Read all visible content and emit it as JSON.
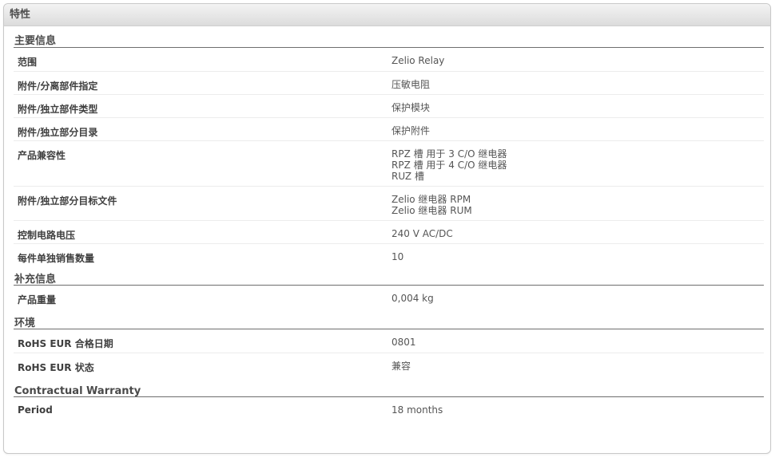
{
  "panel": {
    "title": "特性"
  },
  "sections": [
    {
      "title": "主要信息",
      "rows": [
        {
          "label": "范围",
          "values": [
            "Zelio Relay"
          ]
        },
        {
          "label": "附件/分离部件指定",
          "values": [
            "压敏电阻"
          ]
        },
        {
          "label": "附件/独立部件类型",
          "values": [
            "保护模块"
          ]
        },
        {
          "label": "附件/独立部分目录",
          "values": [
            "保护附件"
          ]
        },
        {
          "label": "产品兼容性",
          "values": [
            "RPZ 槽 用于 3 C/O 继电器",
            "RPZ 槽 用于 4 C/O 继电器",
            "RUZ 槽"
          ]
        },
        {
          "label": "附件/独立部分目标文件",
          "values": [
            "Zelio 继电器 RPM",
            "Zelio 继电器 RUM"
          ]
        },
        {
          "label": "控制电路电压",
          "values": [
            "240 V AC/DC"
          ]
        },
        {
          "label": "每件单独销售数量",
          "values": [
            "10"
          ]
        }
      ]
    },
    {
      "title": "补充信息",
      "rows": [
        {
          "label": "产品重量",
          "values": [
            "0,004 kg"
          ]
        }
      ]
    },
    {
      "title": "环境",
      "rows": [
        {
          "label": "RoHS EUR 合格日期",
          "values": [
            "0801"
          ]
        },
        {
          "label": "RoHS EUR 状态",
          "values": [
            "兼容"
          ]
        }
      ]
    },
    {
      "title": "Contractual Warranty",
      "rows": [
        {
          "label": "Period",
          "values": [
            "18 months"
          ]
        }
      ]
    }
  ]
}
